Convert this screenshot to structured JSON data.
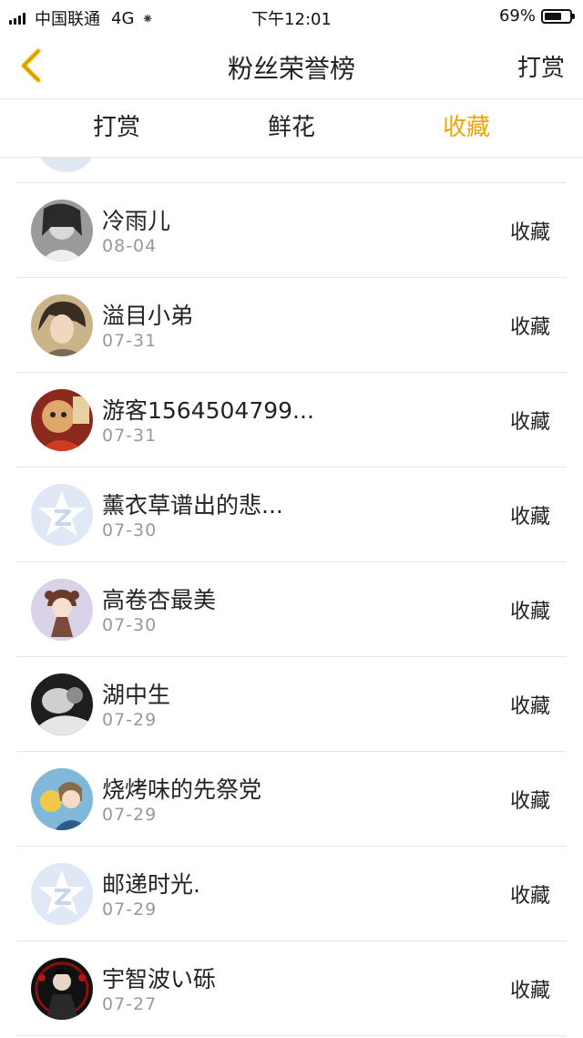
{
  "status_bar": {
    "carrier": "中国联通",
    "network": "4G",
    "loading": "⁕",
    "time": "下午12:01",
    "battery": "69%",
    "battery_level": 0.69
  },
  "nav": {
    "title": "粉丝荣誉榜",
    "action": "打赏"
  },
  "tabs": [
    {
      "label": "打赏",
      "active": false
    },
    {
      "label": "鲜花",
      "active": false
    },
    {
      "label": "收藏",
      "active": true
    }
  ],
  "accent_color": "#f0a400",
  "rows": [
    {
      "name": "冷雨儿",
      "date": "08-04",
      "action": "收藏",
      "avatar": "gray-photo"
    },
    {
      "name": "溢目小弟",
      "date": "07-31",
      "action": "收藏",
      "avatar": "anime-boy"
    },
    {
      "name": "游客1564504799...",
      "date": "07-31",
      "action": "收藏",
      "avatar": "red-doll"
    },
    {
      "name": "薰衣草谱出的悲...",
      "date": "07-30",
      "action": "收藏",
      "avatar": "default-z-icon"
    },
    {
      "name": "高卷杏最美",
      "date": "07-30",
      "action": "收藏",
      "avatar": "chibi-girl"
    },
    {
      "name": "湖中生",
      "date": "07-29",
      "action": "收藏",
      "avatar": "dark-photo"
    },
    {
      "name": "烧烤味的先祭党",
      "date": "07-29",
      "action": "收藏",
      "avatar": "anime-pair"
    },
    {
      "name": "邮递时光.",
      "date": "07-29",
      "action": "收藏",
      "avatar": "default-z-icon"
    },
    {
      "name": "宇智波い砾",
      "date": "07-27",
      "action": "收藏",
      "avatar": "sharingan-dark"
    }
  ]
}
